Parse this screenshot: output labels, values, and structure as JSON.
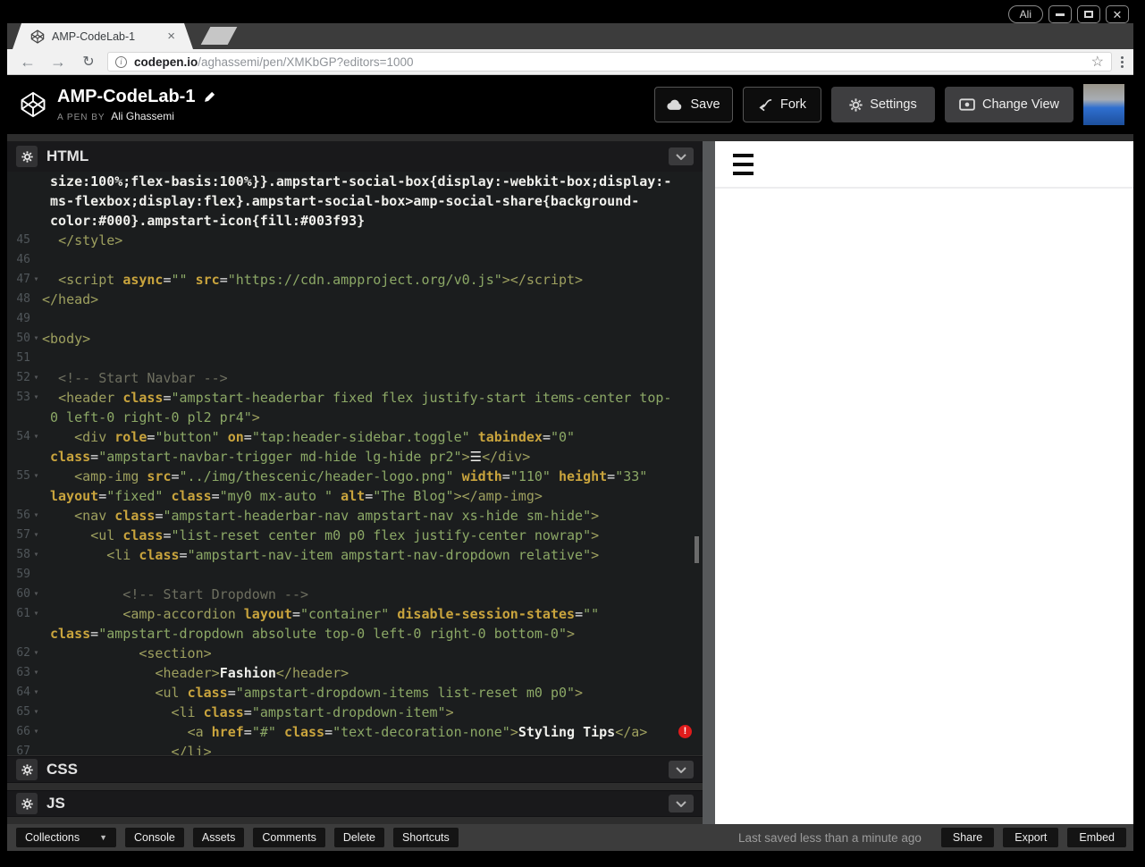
{
  "window": {
    "profile": "Ali"
  },
  "browser": {
    "tab_title": "AMP-CodeLab-1",
    "url_host": "codepen.io",
    "url_path": "/aghassemi/pen/XMKbGP?editors=1000"
  },
  "header": {
    "title": "AMP-CodeLab-1",
    "byline_prefix": "A PEN BY",
    "author": "Ali Ghassemi",
    "save_label": "Save",
    "fork_label": "Fork",
    "settings_label": "Settings",
    "change_view_label": "Change View"
  },
  "panels": {
    "html": "HTML",
    "css": "CSS",
    "js": "JS"
  },
  "statusbar": {
    "collections": "Collections",
    "console": "Console",
    "assets": "Assets",
    "comments": "Comments",
    "delete": "Delete",
    "shortcuts": "Shortcuts",
    "last_saved": "Last saved less than a minute ago",
    "share": "Share",
    "export": "Export",
    "embed": "Embed"
  },
  "editor": {
    "colors": {
      "p": "#f0f0ec",
      "t": "#9ea05f",
      "a": "#c9a43d",
      "s": "#8ca866",
      "o": "#e8e8e8",
      "c": "#6e6f60"
    },
    "rows": [
      {
        "w": 1,
        "seg": [
          [
            "p",
            "size:100%;flex-basis:100%}}.ampstart-social-box{display:-webkit-box;display:-"
          ]
        ]
      },
      {
        "w": 1,
        "seg": [
          [
            "p",
            "ms-flexbox;display:flex}.ampstart-social-box>amp-social-share{background-"
          ]
        ]
      },
      {
        "w": 1,
        "seg": [
          [
            "p",
            "color:#000}.ampstart-icon{fill:#003f93}"
          ]
        ]
      },
      {
        "n": "45",
        "seg": [
          [
            "p",
            "  "
          ],
          [
            "t",
            "</style>"
          ]
        ]
      },
      {
        "n": "46",
        "seg": []
      },
      {
        "n": "47",
        "f": 1,
        "seg": [
          [
            "p",
            "  "
          ],
          [
            "t",
            "<script "
          ],
          [
            "a",
            "async"
          ],
          [
            "o",
            "="
          ],
          [
            "s",
            "\"\""
          ],
          [
            "p",
            " "
          ],
          [
            "a",
            "src"
          ],
          [
            "o",
            "="
          ],
          [
            "s",
            "\"https://cdn.ampproject.org/v0.js\""
          ],
          [
            "t",
            "></script>"
          ]
        ]
      },
      {
        "n": "48",
        "seg": [
          [
            "t",
            "</head>"
          ]
        ]
      },
      {
        "n": "49",
        "seg": []
      },
      {
        "n": "50",
        "f": 1,
        "seg": [
          [
            "t",
            "<body>"
          ]
        ]
      },
      {
        "n": "51",
        "seg": []
      },
      {
        "n": "52",
        "f": 1,
        "seg": [
          [
            "c",
            "  <!-- Start Navbar -->"
          ]
        ]
      },
      {
        "n": "53",
        "f": 1,
        "seg": [
          [
            "p",
            "  "
          ],
          [
            "t",
            "<header "
          ],
          [
            "a",
            "class"
          ],
          [
            "o",
            "="
          ],
          [
            "s",
            "\"ampstart-headerbar fixed flex justify-start items-center top-"
          ]
        ]
      },
      {
        "w": 1,
        "seg": [
          [
            "s",
            "0 left-0 right-0 pl2 pr4\""
          ],
          [
            "t",
            ">"
          ]
        ]
      },
      {
        "n": "54",
        "f": 1,
        "seg": [
          [
            "p",
            "    "
          ],
          [
            "t",
            "<div "
          ],
          [
            "a",
            "role"
          ],
          [
            "o",
            "="
          ],
          [
            "s",
            "\"button\""
          ],
          [
            "p",
            " "
          ],
          [
            "a",
            "on"
          ],
          [
            "o",
            "="
          ],
          [
            "s",
            "\"tap:header-sidebar.toggle\""
          ],
          [
            "p",
            " "
          ],
          [
            "a",
            "tabindex"
          ],
          [
            "o",
            "="
          ],
          [
            "s",
            "\"0\""
          ]
        ]
      },
      {
        "w": 1,
        "seg": [
          [
            "a",
            "class"
          ],
          [
            "o",
            "="
          ],
          [
            "s",
            "\"ampstart-navbar-trigger md-hide lg-hide pr2\""
          ],
          [
            "t",
            ">"
          ],
          [
            "p",
            "☰"
          ],
          [
            "t",
            "</div>"
          ]
        ]
      },
      {
        "n": "55",
        "f": 1,
        "seg": [
          [
            "p",
            "    "
          ],
          [
            "t",
            "<amp-img "
          ],
          [
            "a",
            "src"
          ],
          [
            "o",
            "="
          ],
          [
            "s",
            "\"../img/thescenic/header-logo.png\""
          ],
          [
            "p",
            " "
          ],
          [
            "a",
            "width"
          ],
          [
            "o",
            "="
          ],
          [
            "s",
            "\"110\""
          ],
          [
            "p",
            " "
          ],
          [
            "a",
            "height"
          ],
          [
            "o",
            "="
          ],
          [
            "s",
            "\"33\""
          ]
        ]
      },
      {
        "w": 1,
        "seg": [
          [
            "a",
            "layout"
          ],
          [
            "o",
            "="
          ],
          [
            "s",
            "\"fixed\""
          ],
          [
            "p",
            " "
          ],
          [
            "a",
            "class"
          ],
          [
            "o",
            "="
          ],
          [
            "s",
            "\"my0 mx-auto \""
          ],
          [
            "p",
            " "
          ],
          [
            "a",
            "alt"
          ],
          [
            "o",
            "="
          ],
          [
            "s",
            "\"The Blog\""
          ],
          [
            "t",
            "></amp-img>"
          ]
        ]
      },
      {
        "n": "56",
        "f": 1,
        "seg": [
          [
            "p",
            "    "
          ],
          [
            "t",
            "<nav "
          ],
          [
            "a",
            "class"
          ],
          [
            "o",
            "="
          ],
          [
            "s",
            "\"ampstart-headerbar-nav ampstart-nav xs-hide sm-hide\""
          ],
          [
            "t",
            ">"
          ]
        ]
      },
      {
        "n": "57",
        "f": 1,
        "seg": [
          [
            "p",
            "      "
          ],
          [
            "t",
            "<ul "
          ],
          [
            "a",
            "class"
          ],
          [
            "o",
            "="
          ],
          [
            "s",
            "\"list-reset center m0 p0 flex justify-center nowrap\""
          ],
          [
            "t",
            ">"
          ]
        ]
      },
      {
        "n": "58",
        "f": 1,
        "seg": [
          [
            "p",
            "        "
          ],
          [
            "t",
            "<li "
          ],
          [
            "a",
            "class"
          ],
          [
            "o",
            "="
          ],
          [
            "s",
            "\"ampstart-nav-item ampstart-nav-dropdown relative\""
          ],
          [
            "t",
            ">"
          ]
        ]
      },
      {
        "n": "59",
        "seg": []
      },
      {
        "n": "60",
        "f": 1,
        "seg": [
          [
            "c",
            "          <!-- Start Dropdown -->"
          ]
        ]
      },
      {
        "n": "61",
        "f": 1,
        "seg": [
          [
            "p",
            "          "
          ],
          [
            "t",
            "<amp-accordion "
          ],
          [
            "a",
            "layout"
          ],
          [
            "o",
            "="
          ],
          [
            "s",
            "\"container\""
          ],
          [
            "p",
            " "
          ],
          [
            "a",
            "disable-session-states"
          ],
          [
            "o",
            "="
          ],
          [
            "s",
            "\"\""
          ]
        ]
      },
      {
        "w": 1,
        "seg": [
          [
            "a",
            "class"
          ],
          [
            "o",
            "="
          ],
          [
            "s",
            "\"ampstart-dropdown absolute top-0 left-0 right-0 bottom-0\""
          ],
          [
            "t",
            ">"
          ]
        ]
      },
      {
        "n": "62",
        "f": 1,
        "seg": [
          [
            "p",
            "            "
          ],
          [
            "t",
            "<section>"
          ]
        ]
      },
      {
        "n": "63",
        "f": 1,
        "seg": [
          [
            "p",
            "              "
          ],
          [
            "t",
            "<header>"
          ],
          [
            "p",
            "Fashion"
          ],
          [
            "t",
            "</header>"
          ]
        ]
      },
      {
        "n": "64",
        "f": 1,
        "seg": [
          [
            "p",
            "              "
          ],
          [
            "t",
            "<ul "
          ],
          [
            "a",
            "class"
          ],
          [
            "o",
            "="
          ],
          [
            "s",
            "\"ampstart-dropdown-items list-reset m0 p0\""
          ],
          [
            "t",
            ">"
          ]
        ]
      },
      {
        "n": "65",
        "f": 1,
        "seg": [
          [
            "p",
            "                "
          ],
          [
            "t",
            "<li "
          ],
          [
            "a",
            "class"
          ],
          [
            "o",
            "="
          ],
          [
            "s",
            "\"ampstart-dropdown-item\""
          ],
          [
            "t",
            ">"
          ]
        ]
      },
      {
        "n": "66",
        "f": 1,
        "err": 1,
        "seg": [
          [
            "p",
            "                  "
          ],
          [
            "t",
            "<a "
          ],
          [
            "a",
            "href"
          ],
          [
            "o",
            "="
          ],
          [
            "s",
            "\"#\""
          ],
          [
            "p",
            " "
          ],
          [
            "a",
            "class"
          ],
          [
            "o",
            "="
          ],
          [
            "s",
            "\"text-decoration-none\""
          ],
          [
            "t",
            ">"
          ],
          [
            "p",
            "Styling Tips"
          ],
          [
            "t",
            "</a>"
          ]
        ]
      },
      {
        "n": "67",
        "seg": [
          [
            "p",
            "                "
          ],
          [
            "t",
            "</li>"
          ]
        ]
      }
    ]
  }
}
